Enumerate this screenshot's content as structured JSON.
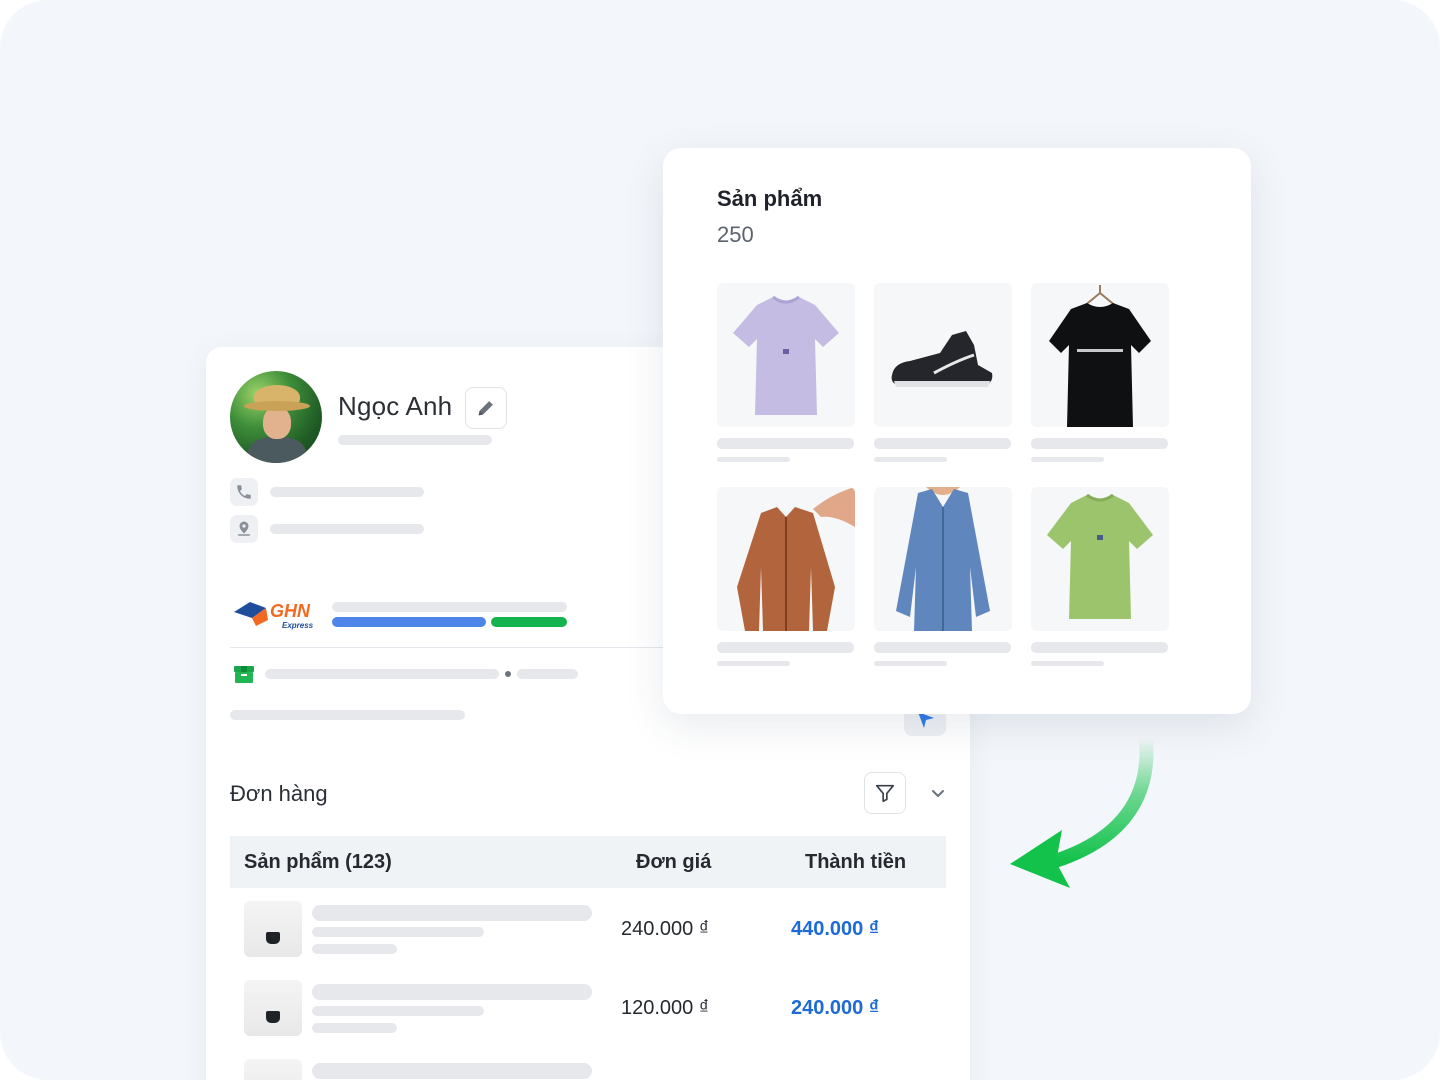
{
  "customer": {
    "name": "Ngọc Anh",
    "avatar_icon": "customer-avatar-photo",
    "edit_icon": "pencil-icon",
    "phone_icon": "phone-icon",
    "address_icon": "location-pin-icon",
    "carrier_logo_text": "GHN",
    "carrier_logo_subtext": "Express",
    "shipment_icon": "package-icon"
  },
  "orders": {
    "title": "Đơn hàng",
    "filter_icon": "filter-icon",
    "collapse_icon": "chevron-down-icon",
    "columns": {
      "product": "Sản phẩm (123)",
      "unit_price": "Đơn giá",
      "total": "Thành tiền"
    },
    "rows": [
      {
        "unit_price": "240.000 ₫",
        "total": "440.000 ₫"
      },
      {
        "unit_price": "120.000 ₫",
        "total": "240.000 ₫"
      }
    ]
  },
  "products_popup": {
    "title": "Sản phẩm",
    "count": "250",
    "items": [
      {
        "image": "lavender-tshirt"
      },
      {
        "image": "black-sneaker"
      },
      {
        "image": "black-tshirt"
      },
      {
        "image": "brown-jacket"
      },
      {
        "image": "blue-blouse"
      },
      {
        "image": "green-tshirt"
      }
    ]
  },
  "colors": {
    "accent_blue": "#1e6ad6",
    "progress_blue": "#4d86e8",
    "progress_green": "#14b34e",
    "arrow_green": "#12c24a"
  }
}
